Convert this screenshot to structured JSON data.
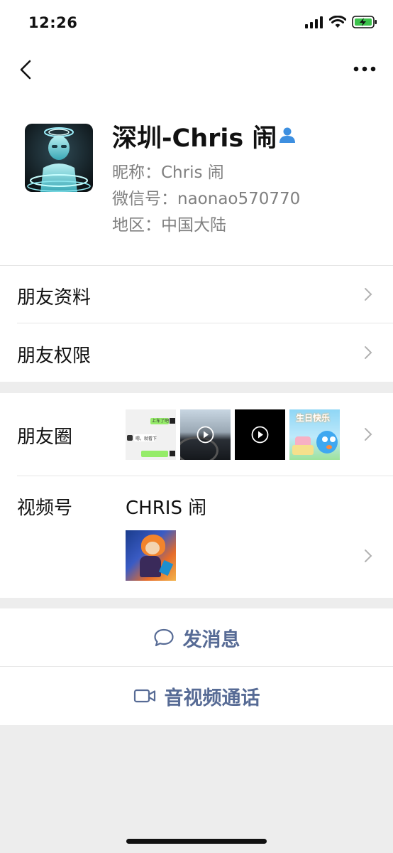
{
  "status": {
    "time": "12:26",
    "icons": [
      "signal-icon",
      "wifi-icon",
      "battery-charging-icon"
    ]
  },
  "nav": {
    "back_icon": "chevron-left-icon",
    "more_icon": "more-horizontal-icon"
  },
  "profile": {
    "display_name": "深圳-Chris 闹",
    "nickname": "昵称：Chris 闹",
    "wechat_id": "微信号：naonao570770",
    "region": "地区：中国大陆",
    "contact_icon": "contact-person-icon"
  },
  "rows": {
    "friend_info": "朋友资料",
    "friend_permissions": "朋友权限",
    "moments": "朋友圈",
    "channels": "视频号",
    "channels_name": "CHRIS 闹"
  },
  "moments_thumbs": {
    "chat_bubble_1": "上车了吧",
    "chat_bubble_2": "嗯，就看下",
    "birthday_text": "生日快乐"
  },
  "actions": {
    "send_message": "发消息",
    "video_call": "音视频通话",
    "message_icon": "chat-bubble-icon",
    "video_icon": "video-camera-icon"
  },
  "colors": {
    "link_blue": "#576b95",
    "secondary_text": "#808080",
    "background": "#ededed",
    "contact_icon_blue": "#3d8fe0"
  }
}
